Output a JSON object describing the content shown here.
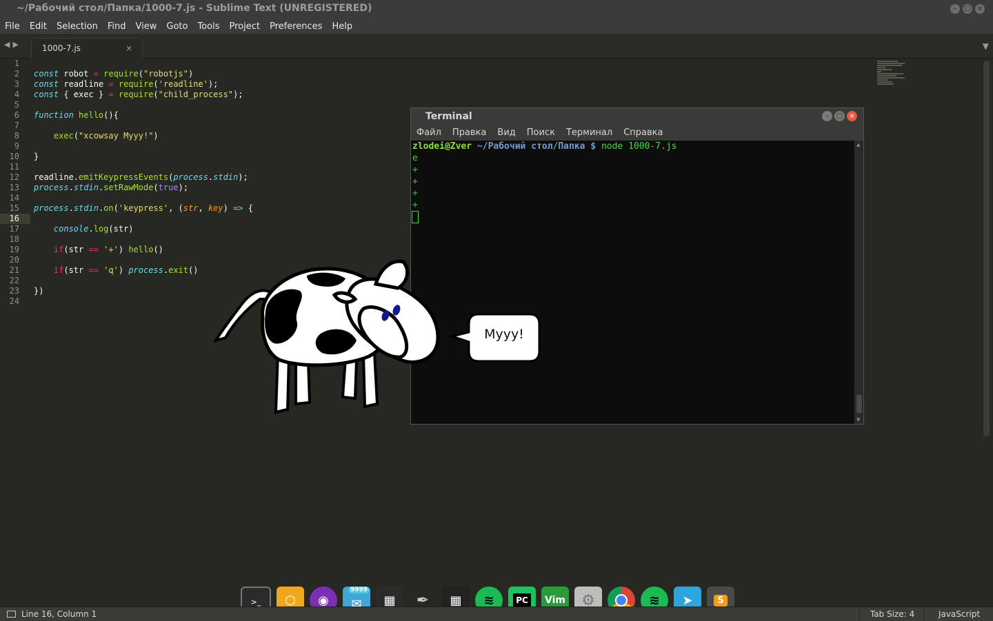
{
  "window": {
    "title": "~/Рабочий стол/Папка/1000-7.js - Sublime Text (UNREGISTERED)"
  },
  "menu": [
    "File",
    "Edit",
    "Selection",
    "Find",
    "View",
    "Goto",
    "Tools",
    "Project",
    "Preferences",
    "Help"
  ],
  "tab": {
    "label": "1000-7.js",
    "close": "×"
  },
  "editor": {
    "current_line": 16,
    "lines": [
      "1",
      "2",
      "3",
      "4",
      "5",
      "6",
      "7",
      "8",
      "9",
      "10",
      "11",
      "12",
      "13",
      "14",
      "15",
      "16",
      "17",
      "18",
      "19",
      "20",
      "21",
      "22",
      "23",
      "24"
    ]
  },
  "terminal": {
    "title": "Terminal",
    "menu": [
      "Файл",
      "Правка",
      "Вид",
      "Поиск",
      "Терминал",
      "Справка"
    ],
    "prompt_user": "zlodei@Zver",
    "prompt_path": "~/Рабочий стол/Папка $",
    "command": "node 1000-7.js",
    "output": [
      "e",
      "+",
      "+",
      "+",
      "+"
    ]
  },
  "cowsay": {
    "text": "Myyy!"
  },
  "dock": [
    {
      "name": "terminal-app",
      "icon": "terminal-icon",
      "color": "#2b2b2b"
    },
    {
      "name": "yellow-app",
      "icon": "hexagon-icon",
      "color": "#f0a81a"
    },
    {
      "name": "tor-browser",
      "icon": "onion-icon",
      "color": "#7a2fb5"
    },
    {
      "name": "messenger-app",
      "icon": "chat-icon",
      "color": "#3fa6d6",
      "badge": "9999"
    },
    {
      "name": "apps-grid",
      "icon": "grid-icon",
      "color": "#2b2b2b"
    },
    {
      "name": "inkscape",
      "icon": "pen-icon",
      "color": "#1e1e1e"
    },
    {
      "name": "apps-grid-2",
      "icon": "grid-icon",
      "color": "#222"
    },
    {
      "name": "spotify",
      "icon": "spotify-icon",
      "color": "#1db954"
    },
    {
      "name": "pycharm",
      "icon": "pycharm-icon",
      "color": "#20c060"
    },
    {
      "name": "vim",
      "icon": "vim-icon",
      "color": "#2a9a3a"
    },
    {
      "name": "settings-app",
      "icon": "gears-icon",
      "color": "#bdbdbd"
    },
    {
      "name": "chrome",
      "icon": "chrome-icon",
      "color": "#e8e8e8"
    },
    {
      "name": "spotify-2",
      "icon": "spotify-icon",
      "color": "#1db954"
    },
    {
      "name": "telegram",
      "icon": "telegram-icon",
      "color": "#2ca5e0"
    },
    {
      "name": "sublime-text",
      "icon": "sublime-icon",
      "color": "#4a4a4a"
    }
  ],
  "status": {
    "position": "Line 16, Column 1",
    "tab_size": "Tab Size: 4",
    "syntax": "JavaScript"
  }
}
